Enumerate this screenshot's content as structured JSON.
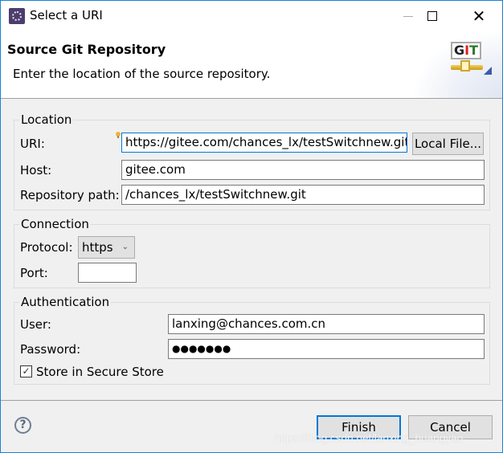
{
  "window": {
    "title": "Select a URI",
    "controls": {
      "minimize": "—",
      "maximize": "☐",
      "close": "✕"
    }
  },
  "header": {
    "title": "Source Git Repository",
    "description": "Enter the location of the source repository.",
    "logo": {
      "g": "G",
      "i": "I",
      "t": "T"
    }
  },
  "location": {
    "legend": "Location",
    "uri_label": "URI:",
    "uri_value": "https://gitee.com/chances_lx/testSwitchnew.git",
    "local_file_button": "Local File...",
    "host_label": "Host:",
    "host_value": "gitee.com",
    "repo_path_label": "Repository path:",
    "repo_path_value": "/chances_lx/testSwitchnew.git"
  },
  "connection": {
    "legend": "Connection",
    "protocol_label": "Protocol:",
    "protocol_value": "https",
    "port_label": "Port:",
    "port_value": ""
  },
  "authentication": {
    "legend": "Authentication",
    "user_label": "User:",
    "user_value": "lanxing@chances.com.cn",
    "password_label": "Password:",
    "password_mask": "●●●●●●●",
    "store_label": "Store in Secure Store",
    "store_checked": true,
    "check_glyph": "✓"
  },
  "footer": {
    "help_glyph": "?",
    "finish_button": "Finish",
    "cancel_button": "Cancel"
  },
  "watermark": "https://blog.csdn.net/lanxing_huangyao"
}
